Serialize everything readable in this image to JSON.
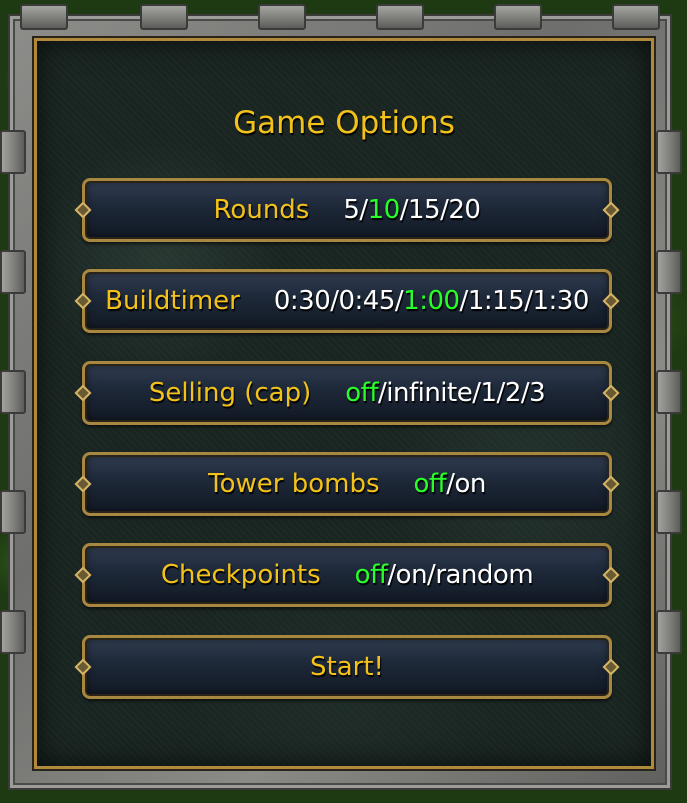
{
  "dialog": {
    "title": "Game Options",
    "accent_color": "#f2c21a",
    "selected_color": "#28ff28",
    "value_color": "#ffffff"
  },
  "options": [
    {
      "label": "Rounds",
      "values": [
        "5",
        "10",
        "15",
        "20"
      ],
      "selected": "10"
    },
    {
      "label": "Buildtimer",
      "values": [
        "0:30",
        "0:45",
        "1:00",
        "1:15",
        "1:30"
      ],
      "selected": "1:00"
    },
    {
      "label": "Selling (cap)",
      "values": [
        "off",
        "infinite",
        "1",
        "2",
        "3"
      ],
      "selected": "off"
    },
    {
      "label": "Tower bombs",
      "values": [
        "off",
        "on"
      ],
      "selected": "off"
    },
    {
      "label": "Checkpoints",
      "values": [
        "off",
        "on",
        "random"
      ],
      "selected": "off"
    }
  ],
  "start_button": {
    "label": "Start!"
  }
}
